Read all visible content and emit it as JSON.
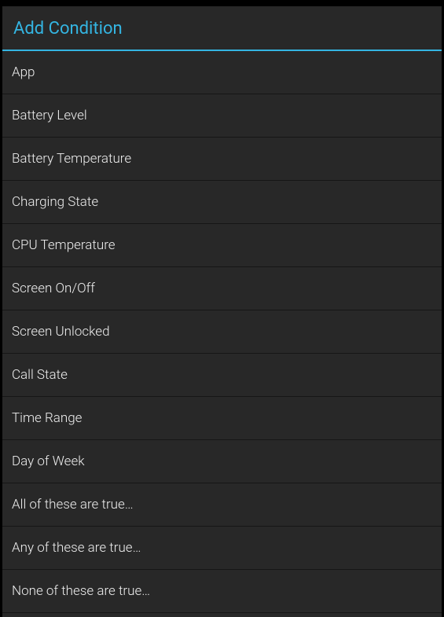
{
  "background_hint": "",
  "dialog": {
    "title": "Add Condition",
    "items": [
      {
        "label": "App"
      },
      {
        "label": "Battery Level"
      },
      {
        "label": "Battery Temperature"
      },
      {
        "label": "Charging State"
      },
      {
        "label": "CPU Temperature"
      },
      {
        "label": "Screen On/Off"
      },
      {
        "label": "Screen Unlocked"
      },
      {
        "label": "Call State"
      },
      {
        "label": "Time Range"
      },
      {
        "label": "Day of Week"
      },
      {
        "label": "All of these are true…"
      },
      {
        "label": "Any of these are true…"
      },
      {
        "label": "None of these are true…"
      }
    ]
  }
}
